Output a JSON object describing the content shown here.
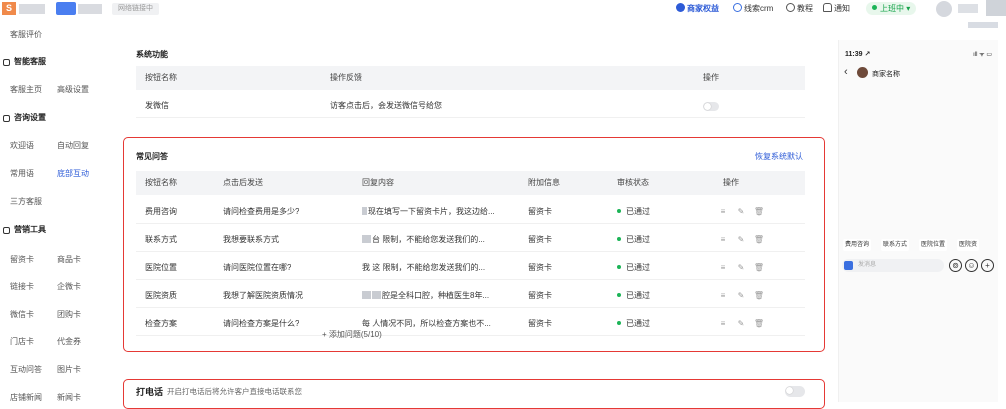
{
  "topbar": {
    "logo_glyph": "S",
    "tag": "网络链接中",
    "merchant_rights": "商家权益",
    "crm": "线索crm",
    "course": "教程",
    "notice": "通知",
    "status": "上班中 ▾"
  },
  "sidebar": {
    "customer_review": "客服评价",
    "smart_service_group": "智能客服",
    "service_home": "客服主页",
    "advanced_settings": "高级设置",
    "consult_group": "咨询设置",
    "welcome": "欢迎语",
    "auto_reply": "自动回复",
    "common_words": "常用语",
    "bottom_interaction": "底部互动",
    "third_party": "三方客服",
    "marketing_group": "营销工具",
    "lead_card": "留资卡",
    "product_card": "商品卡",
    "link_card": "链接卡",
    "wechat_card": "企微卡",
    "weixin_card": "微信卡",
    "group_buy_card": "团购卡",
    "store_card": "门店卡",
    "voucher": "代金券",
    "interactive_qa": "互动问答",
    "image_card": "图片卡",
    "store_news": "店铺新闻",
    "news_card": "新闻卡"
  },
  "system_functions": {
    "title": "系统功能",
    "headers": [
      "按钮名称",
      "操作反馈",
      "操作"
    ],
    "rows": [
      {
        "name": "发微信",
        "feedback": "访客点击后，会发送微信号给您",
        "enabled": false
      }
    ]
  },
  "faq": {
    "title": "常见问答",
    "restore": "恢复系统默认",
    "headers": [
      "按钮名称",
      "点击后发送",
      "回复内容",
      "附加信息",
      "审核状态",
      "操作"
    ],
    "rows": [
      {
        "name": "费用咨询",
        "send": "请问检查费用是多少?",
        "reply": "现在填写一下留资卡片，我这边给...",
        "extra": "留资卡",
        "status": "已通过"
      },
      {
        "name": "联系方式",
        "send": "我想要联系方式",
        "reply": "台 限制，不能给您发送我们的...",
        "extra": "留资卡",
        "status": "已通过"
      },
      {
        "name": "医院位置",
        "send": "请问医院位置在哪?",
        "reply": "我 这 限制，不能给您发送我们的...",
        "extra": "留资卡",
        "status": "已通过"
      },
      {
        "name": "医院资质",
        "send": "我想了解医院资质情况",
        "reply": "腔是全科口腔，种植医生8年...",
        "extra": "留资卡",
        "status": "已通过"
      },
      {
        "name": "检查方案",
        "send": "请问检查方案是什么?",
        "reply": "每 人情况不同，所以检查方案也不...",
        "extra": "留资卡",
        "status": "已通过"
      }
    ],
    "add_label": "+ 添加问题(5/10)"
  },
  "phone_call": {
    "title": "打电话",
    "desc": "开启打电话后将允许客户直接电话联系您",
    "enabled": false
  },
  "preview": {
    "time": "11:39 ↗",
    "signal": "ıll ᯤ ▭",
    "merchant_name": "商家名称",
    "chips": [
      "费用咨询",
      "联系方式",
      "医院位置",
      "医院资"
    ],
    "input_placeholder": "发消息"
  }
}
